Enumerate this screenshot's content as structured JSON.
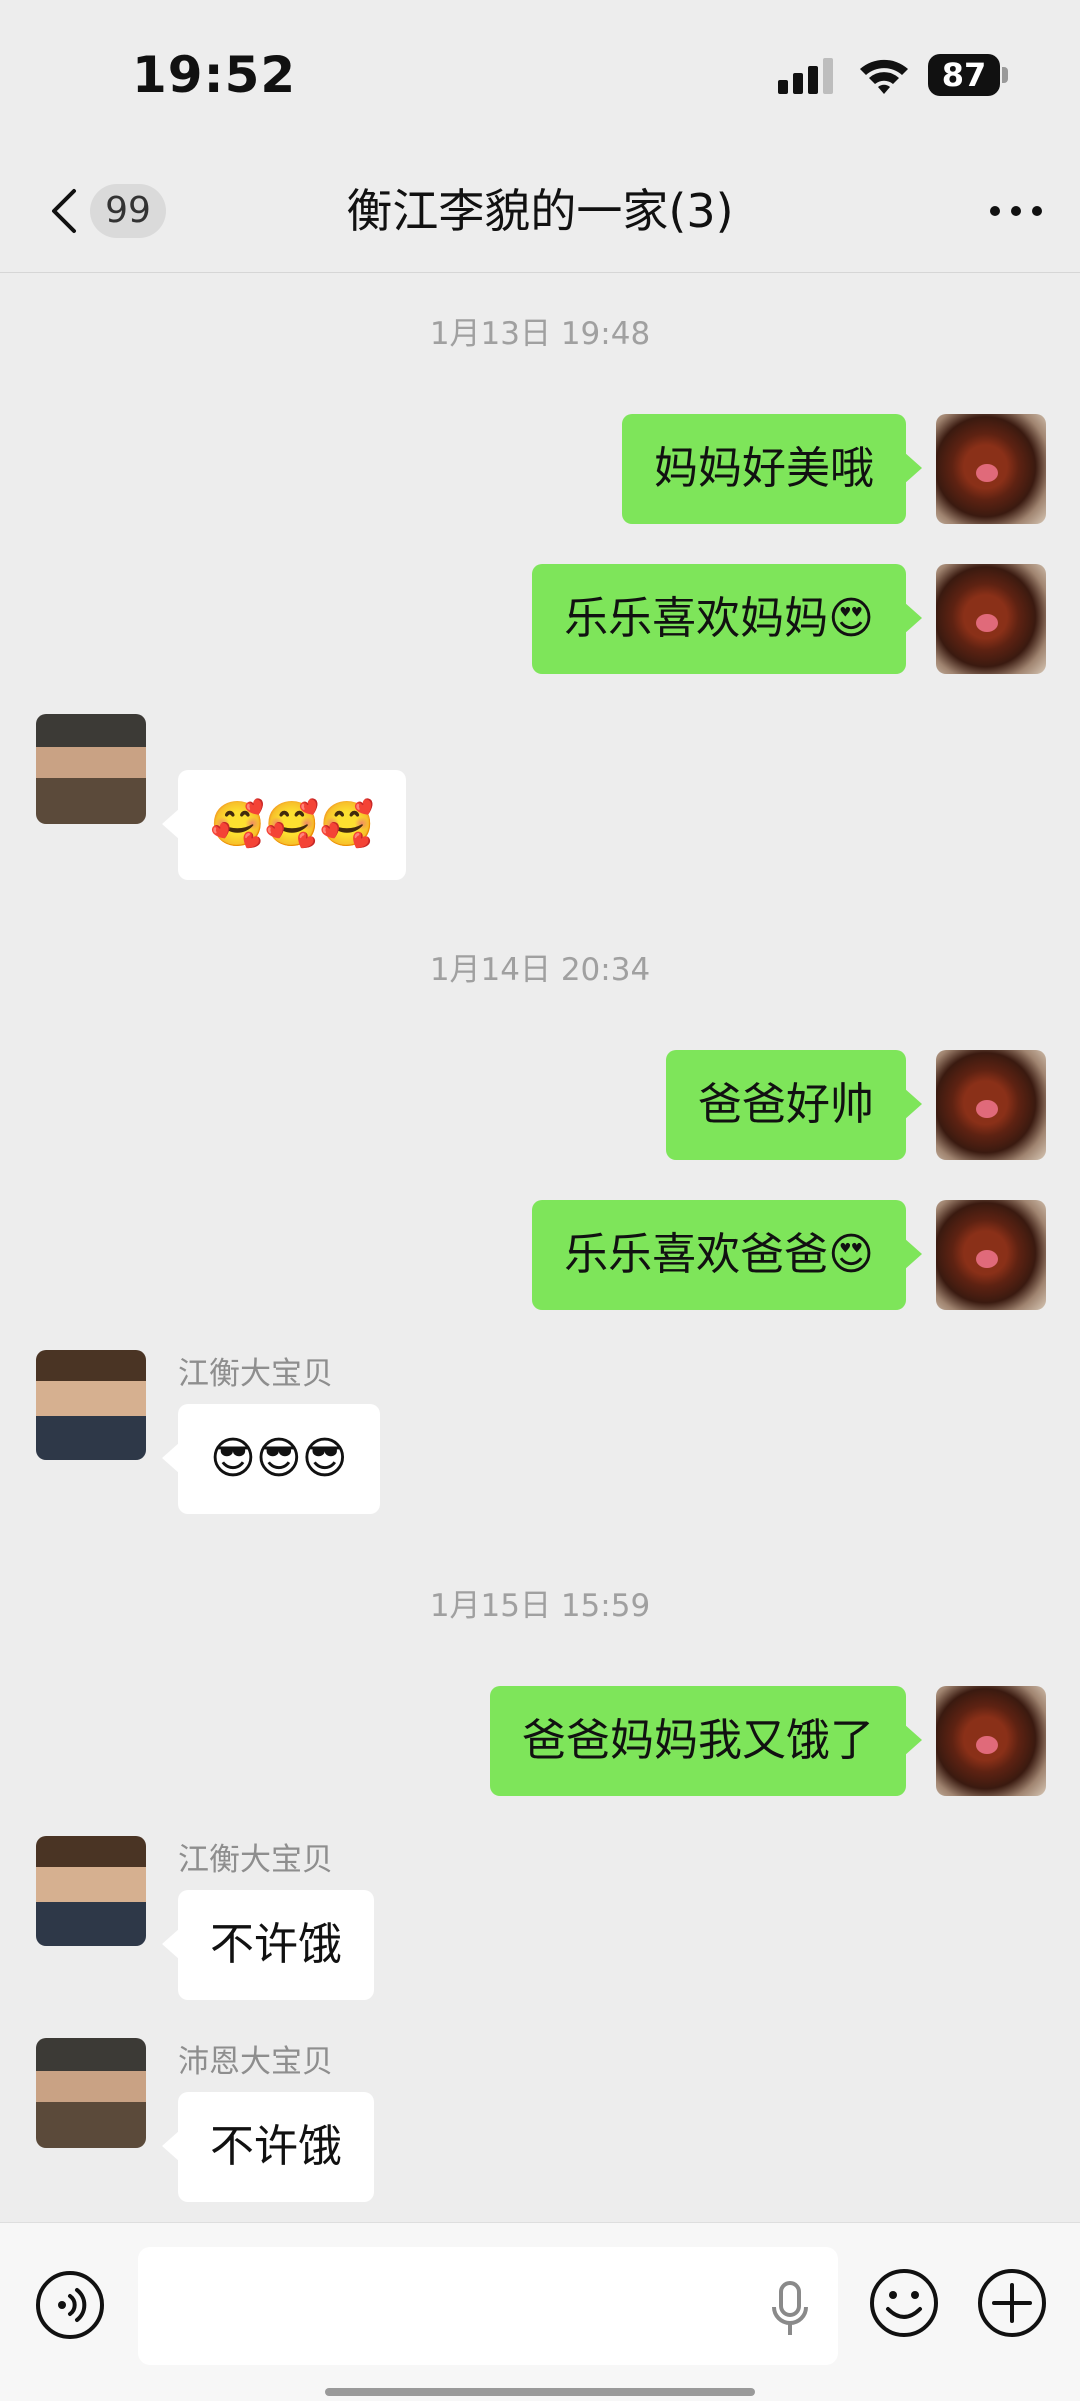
{
  "status_bar": {
    "time": "19:52",
    "battery": "87"
  },
  "nav": {
    "back_count": "99",
    "title": "衡江李貌的一家(3)"
  },
  "messages": {
    "ts1": "1月13日 19:48",
    "m1": "妈妈好美哦",
    "m2": "乐乐喜欢妈妈😍",
    "m3": "🥰🥰🥰",
    "ts2": "1月14日 20:34",
    "m4": "爸爸好帅",
    "m5": "乐乐喜欢爸爸😍",
    "m6_sender": "江衡大宝贝",
    "m6": "😎😎😎",
    "ts3": "1月15日 15:59",
    "m7": "爸爸妈妈我又饿了",
    "m8_sender": "江衡大宝贝",
    "m8": "不许饿",
    "m9_sender": "沛恩大宝贝",
    "m9": "不许饿"
  },
  "input": {
    "value": "",
    "placeholder": ""
  },
  "icons": {
    "back": "chevron-left-icon",
    "more": "more-dots-icon",
    "voice": "voice-icon",
    "mic": "microphone-icon",
    "emoji": "emoji-icon",
    "plus": "plus-icon"
  }
}
